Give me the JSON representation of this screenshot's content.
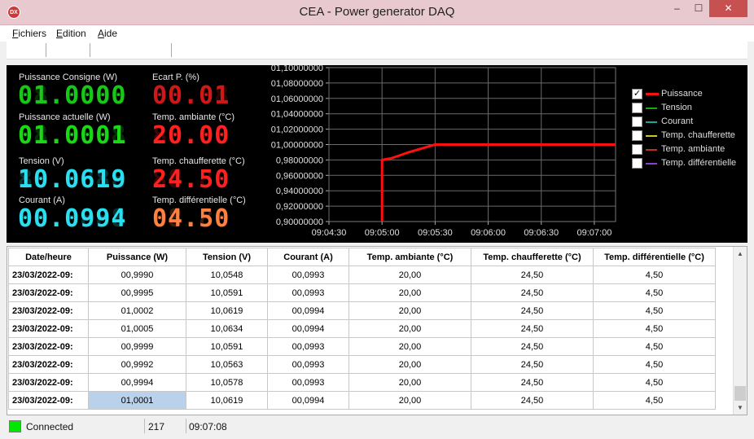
{
  "window": {
    "title": "CEA - Power generator DAQ",
    "icon": "DX",
    "controls": {
      "minimize": "–",
      "maximize": "☐",
      "close": "✕"
    }
  },
  "menu": [
    {
      "label": "Fichiers",
      "accel": "F",
      "rest": "ichiers"
    },
    {
      "label": "Edition",
      "accel": "E",
      "rest": "dition"
    },
    {
      "label": "Aide",
      "accel": "A",
      "rest": "ide"
    }
  ],
  "readouts": {
    "puissance_consigne": {
      "label": "Puissance Consigne (W)",
      "value": "01.0000",
      "ghost": "88.8888",
      "color": "#18c818"
    },
    "ecart_p": {
      "label": "Ecart P. (%)",
      "value": "00.01",
      "ghost": "88.88",
      "color": "#d01818"
    },
    "puissance_actuelle": {
      "label": "Puissance actuelle (W)",
      "value": "01.0001",
      "ghost": "88.8888",
      "color": "#18d818"
    },
    "temp_ambiante": {
      "label": "Temp. ambiante (°C)",
      "value": "20.00",
      "ghost": "88.88",
      "color": "#ff2020"
    },
    "tension": {
      "label": "Tension (V)",
      "value": "10.0619",
      "ghost": "88.8888",
      "color": "#28e0f0"
    },
    "temp_chaufferette": {
      "label": "Temp. chaufferette (°C)",
      "value": "24.50",
      "ghost": "88.88",
      "color": "#ff2020"
    },
    "courant": {
      "label": "Courant (A)",
      "value": "00.0994",
      "ghost": "88.8888",
      "color": "#28e0f0"
    },
    "temp_differentielle": {
      "label": "Temp. différentielle (°C)",
      "value": "04.50",
      "ghost": "88.88",
      "color": "#ff8040"
    }
  },
  "chart_data": {
    "type": "line",
    "title": "",
    "xlabel": "",
    "ylabel": "",
    "x_ticks": [
      "09:04:30",
      "09:05:00",
      "09:05:30",
      "09:06:00",
      "09:06:30",
      "09:07:00"
    ],
    "y_ticks": [
      "0,90000000",
      "0,92000000",
      "0,94000000",
      "0,96000000",
      "0,98000000",
      "01,00000000",
      "01,02000000",
      "01,04000000",
      "01,06000000",
      "01,08000000",
      "01,10000000"
    ],
    "ylim": [
      0.9,
      1.1
    ],
    "xlim": [
      "09:04:30",
      "09:07:12"
    ],
    "grid": true,
    "legend_position": "right",
    "series": [
      {
        "name": "Puissance",
        "color": "#ff1010",
        "x": [
          "09:05:00",
          "09:05:00",
          "09:05:05",
          "09:05:15",
          "09:05:30",
          "09:06:00",
          "09:06:30",
          "09:07:00",
          "09:07:12"
        ],
        "y": [
          0.9,
          0.98,
          0.982,
          0.99,
          1.0,
          1.0,
          1.0,
          1.0,
          1.0
        ]
      }
    ]
  },
  "legend": [
    {
      "label": "Puissance",
      "checked": true,
      "color": "#ff1010"
    },
    {
      "label": "Tension",
      "checked": false,
      "color": "#18a818"
    },
    {
      "label": "Courant",
      "checked": false,
      "color": "#20a0a0"
    },
    {
      "label": "Temp. chaufferette",
      "checked": false,
      "color": "#c8c820"
    },
    {
      "label": "Temp. ambiante",
      "checked": false,
      "color": "#b83020"
    },
    {
      "label": "Temp. différentielle",
      "checked": false,
      "color": "#9040c0"
    }
  ],
  "table": {
    "headers": [
      "Date/heure",
      "Puissance (W)",
      "Tension (V)",
      "Courant (A)",
      "Temp. ambiante (°C)",
      "Temp. chaufferette (°C)",
      "Temp. différentielle (°C)"
    ],
    "rows": [
      [
        "23/03/2022-09:",
        "00,9990",
        "10,0548",
        "00,0993",
        "20,00",
        "24,50",
        "4,50"
      ],
      [
        "23/03/2022-09:",
        "00,9995",
        "10,0591",
        "00,0993",
        "20,00",
        "24,50",
        "4,50"
      ],
      [
        "23/03/2022-09:",
        "01,0002",
        "10,0619",
        "00,0994",
        "20,00",
        "24,50",
        "4,50"
      ],
      [
        "23/03/2022-09:",
        "01,0005",
        "10,0634",
        "00,0994",
        "20,00",
        "24,50",
        "4,50"
      ],
      [
        "23/03/2022-09:",
        "00,9999",
        "10,0591",
        "00,0993",
        "20,00",
        "24,50",
        "4,50"
      ],
      [
        "23/03/2022-09:",
        "00,9992",
        "10,0563",
        "00,0993",
        "20,00",
        "24,50",
        "4,50"
      ],
      [
        "23/03/2022-09:",
        "00,9994",
        "10,0578",
        "00,0993",
        "20,00",
        "24,50",
        "4,50"
      ],
      [
        "23/03/2022-09:",
        "01,0001",
        "10,0619",
        "00,0994",
        "20,00",
        "24,50",
        "4,50"
      ]
    ],
    "selected": {
      "row": 7,
      "col": 1
    }
  },
  "status": {
    "connection": "Connected",
    "led_color": "#00e800",
    "count": "217",
    "time": "09:07:08"
  }
}
